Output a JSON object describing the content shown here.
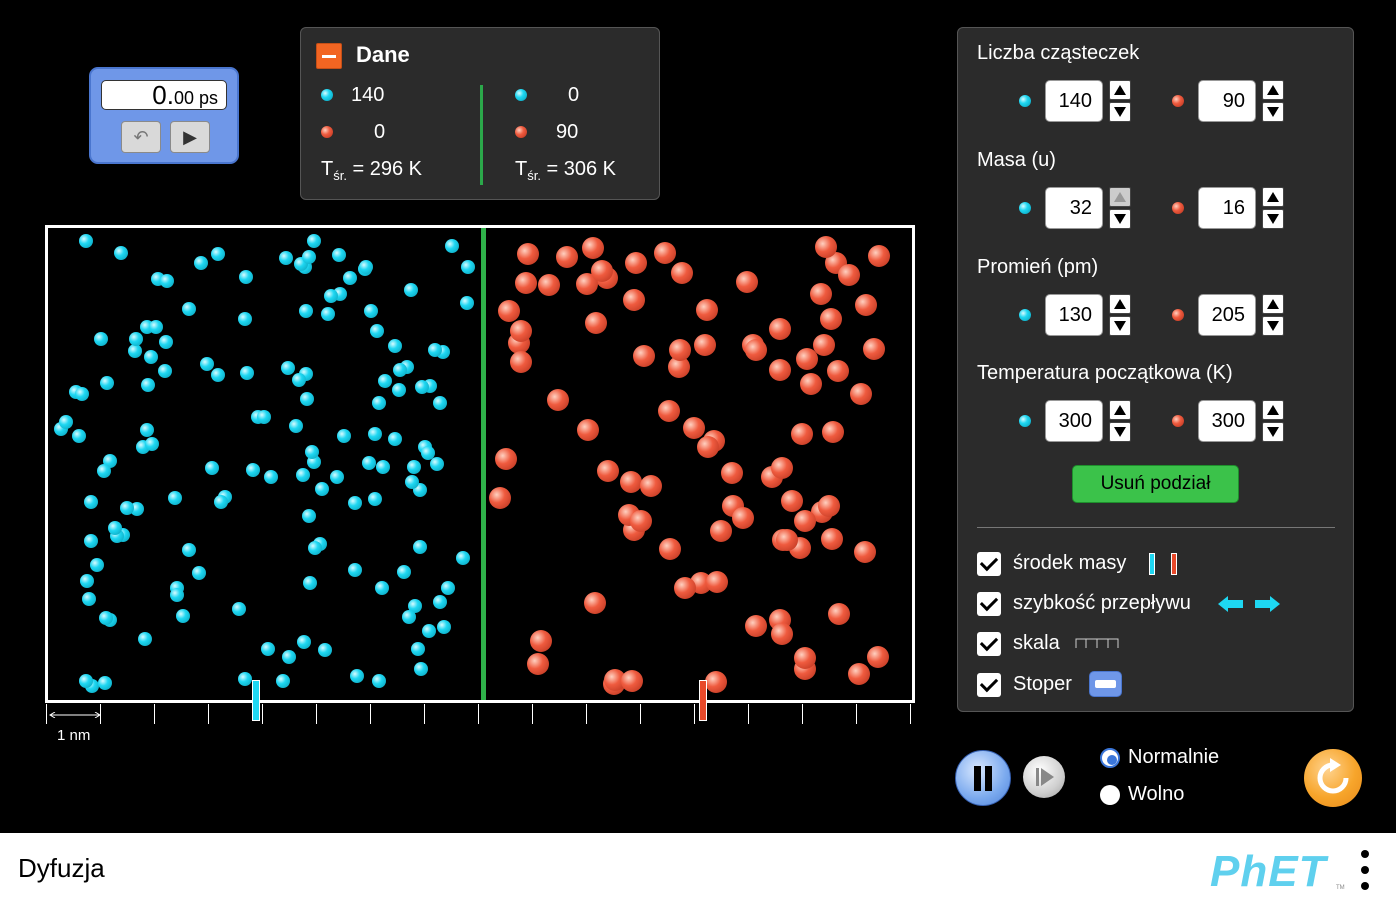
{
  "stopwatch": {
    "value": "0.",
    "decimals": "00",
    "unit": "ps",
    "reset_label": "↶",
    "play_label": "▶"
  },
  "data_panel": {
    "title": "Dane",
    "left": {
      "cyan_count": "140",
      "red_count": "0",
      "temp_label": "T",
      "temp_sub": "śr.",
      "temp_value": "= 296 K"
    },
    "right": {
      "cyan_count": "0",
      "red_count": "90",
      "temp_label": "T",
      "temp_sub": "śr.",
      "temp_value": "= 306 K"
    }
  },
  "scale": {
    "label": "1 nm"
  },
  "control_panel": {
    "particles_label": "Liczba cząsteczek",
    "particles": {
      "cyan": "140",
      "red": "90"
    },
    "mass_label": "Masa (u)",
    "mass": {
      "cyan": "32",
      "red": "16"
    },
    "radius_label": "Promień (pm)",
    "radius": {
      "cyan": "130",
      "red": "205"
    },
    "temp_label": "Temperatura początkowa (K)",
    "temp": {
      "cyan": "300",
      "red": "300"
    },
    "remove_divider_label": "Usuń podział",
    "checkboxes": [
      "środek masy",
      "szybkość przepływu",
      "skala",
      "Stoper"
    ]
  },
  "speed": {
    "normal": "Normalnie",
    "slow": "Wolno"
  },
  "footer": {
    "title": "Dyfuzja",
    "logo": "PhET",
    "tm": "TM"
  },
  "colors": {
    "cyan": "#1ed7f2",
    "red": "#e8492a",
    "divider": "#2fb24a",
    "panel": "#2b2b2b"
  }
}
